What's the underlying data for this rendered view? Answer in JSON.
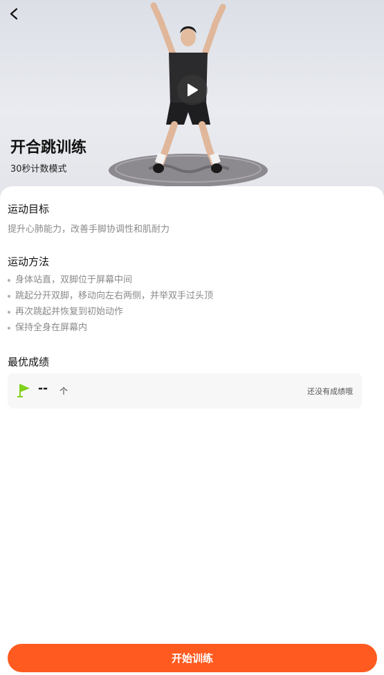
{
  "header": {
    "back_icon": "chevron-left-icon",
    "title": "开合跳训练",
    "subtitle": "30秒计数模式",
    "play_icon": "play-icon"
  },
  "goal": {
    "title": "运动目标",
    "text": "提升心肺能力，改善手脚协调性和肌耐力"
  },
  "method": {
    "title": "运动方法",
    "steps": [
      "身体站直，双脚位于屏幕中间",
      "跳起分开双脚，移动向左右两侧，并举双手过头顶",
      "再次跳起并恢复到初始动作",
      "保持全身在屏幕内"
    ]
  },
  "best": {
    "title": "最优成绩",
    "flag_icon": "flag-icon",
    "value": "--",
    "unit": "个",
    "note": "还没有成绩哦"
  },
  "footer": {
    "start_label": "开始训练"
  },
  "colors": {
    "accent": "#ff5a1f",
    "flag": "#7fd11b"
  }
}
